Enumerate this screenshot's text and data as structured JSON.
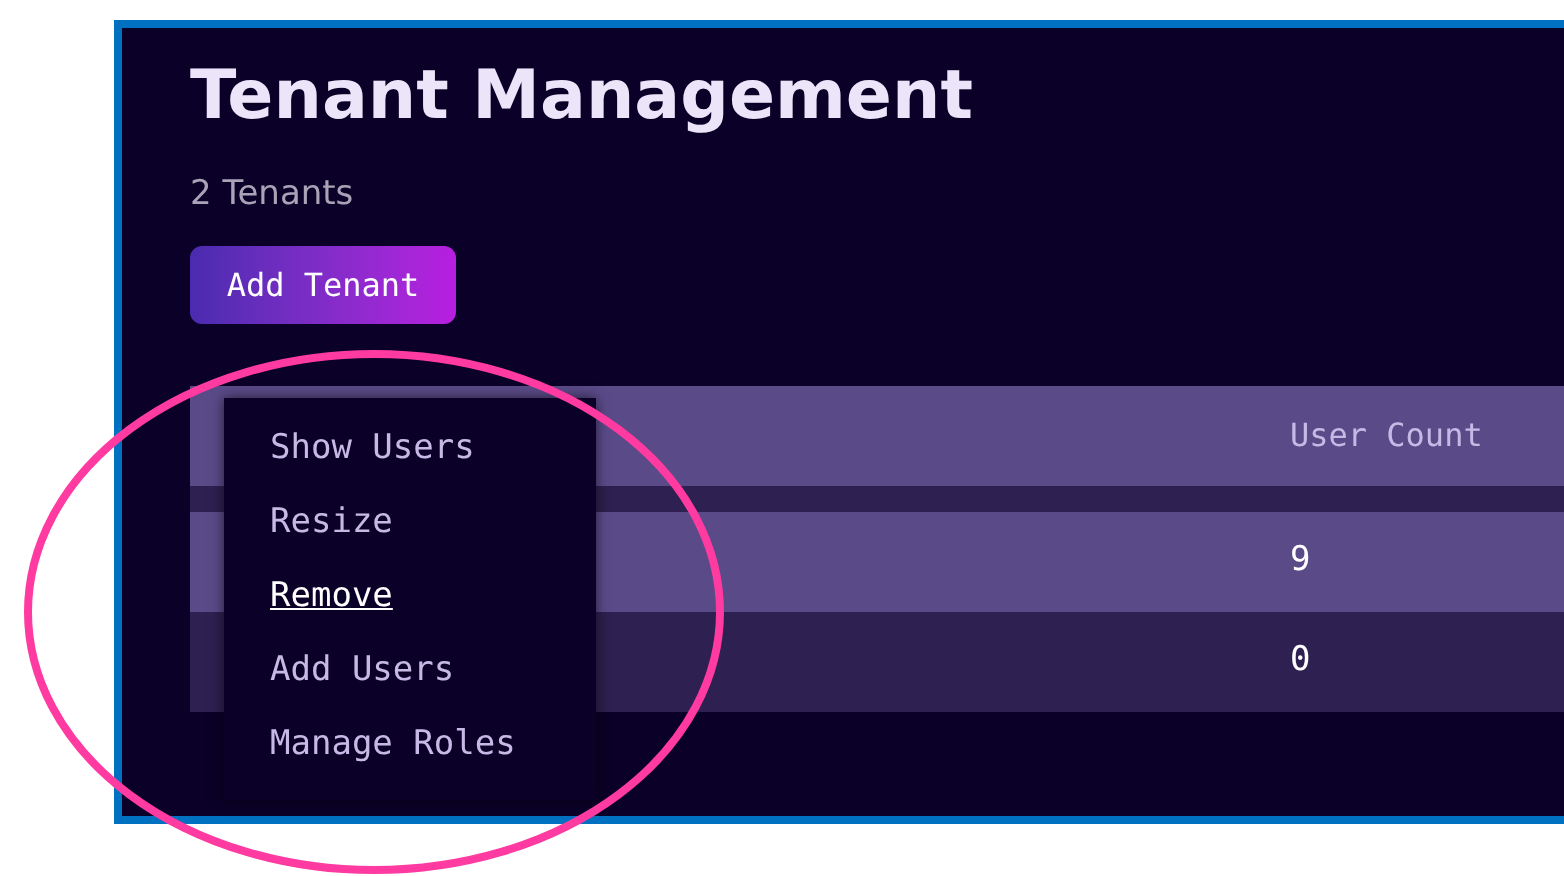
{
  "page": {
    "title": "Tenant Management",
    "subtitle": "2 Tenants"
  },
  "add_button": {
    "label": "Add Tenant"
  },
  "table": {
    "columns": [
      {
        "label": "User Count"
      }
    ],
    "rows": [
      {
        "user_count": "9"
      },
      {
        "user_count": "0"
      }
    ]
  },
  "context_menu": {
    "items": [
      {
        "label": "Show Users",
        "selected": false
      },
      {
        "label": "Resize",
        "selected": false
      },
      {
        "label": "Remove",
        "selected": true
      },
      {
        "label": "Add Users",
        "selected": false
      },
      {
        "label": "Manage Roles",
        "selected": false
      }
    ]
  }
}
